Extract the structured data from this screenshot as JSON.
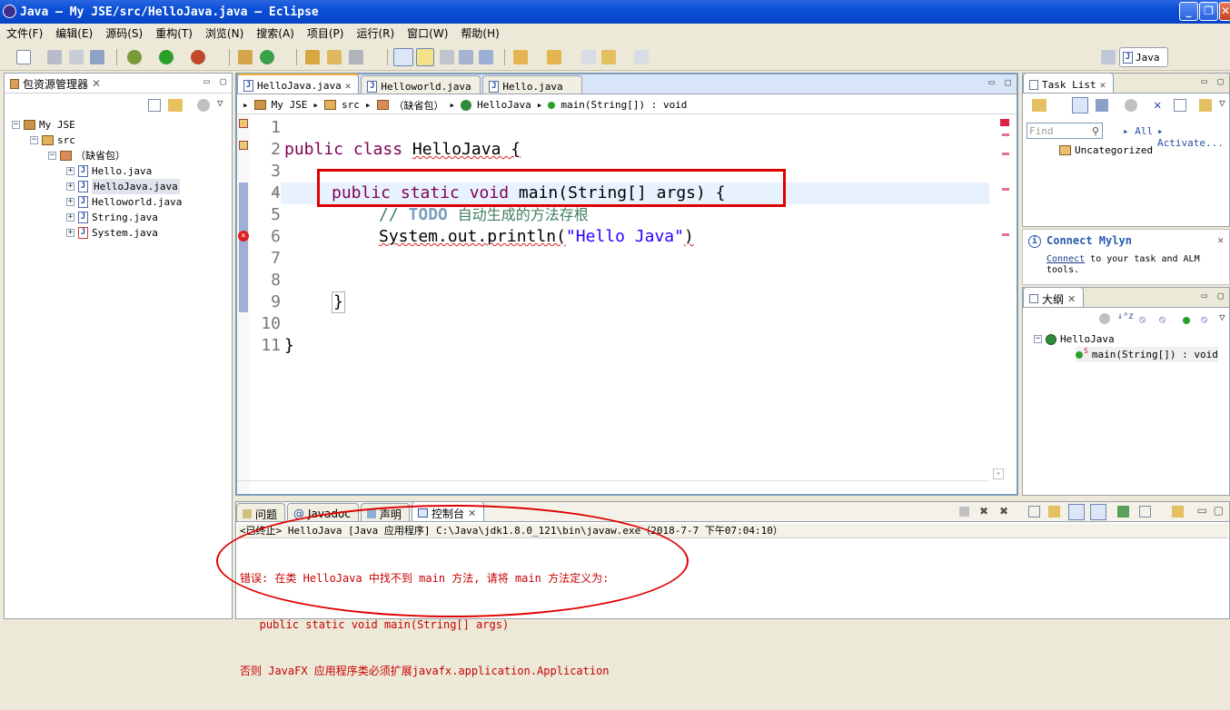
{
  "window": {
    "title": "Java — My JSE/src/HelloJava.java — Eclipse"
  },
  "menu": [
    "文件(F)",
    "编辑(E)",
    "源码(S)",
    "重构(T)",
    "浏览(N)",
    "搜索(A)",
    "项目(P)",
    "运行(R)",
    "窗口(W)",
    "帮助(H)"
  ],
  "perspective": {
    "label": "Java"
  },
  "package_explorer": {
    "title": "包资源管理器",
    "project": "My JSE",
    "src": "src",
    "default_pkg": "（缺省包）",
    "files": [
      "Hello.java",
      "HelloJava.java",
      "Helloworld.java",
      "String.java",
      "System.java"
    ],
    "selected": "HelloJava.java"
  },
  "editor": {
    "tabs": [
      "HelloJava.java",
      "Helloworld.java",
      "Hello.java"
    ],
    "breadcrumb": [
      "My JSE",
      "src",
      "（缺省包）",
      "HelloJava",
      "main(String[]) : void"
    ],
    "line_numbers": [
      "1",
      "2",
      "3",
      "4",
      "5",
      "6",
      "7",
      "8",
      "9",
      "10",
      "11"
    ],
    "code": {
      "l2_kw": "public class",
      "l2_name": "HelloJava {",
      "l4_kw": "public static void",
      "l4_rest": "main(String[] args)",
      "l4_brace": "{",
      "l5_slash": "//",
      "l5_todo": "TODO",
      "l5_text": "自动生成的方法存根",
      "l6_pre": "System.out.println(",
      "l6_str": "\"Hello Java\"",
      "l6_post": ")",
      "l9": "}",
      "l11": "}"
    }
  },
  "task_list": {
    "title": "Task List",
    "find_placeholder": "Find",
    "all": "All",
    "activate": "Activate...",
    "uncategorized": "Uncategorized"
  },
  "mylyn": {
    "title": "Connect Mylyn",
    "link": "Connect",
    "text1": " to your task and ALM",
    "text2": "tools."
  },
  "outline": {
    "title": "大纲",
    "class": "HelloJava",
    "method": "main(String[]) : void"
  },
  "console": {
    "tabs": [
      "问题",
      "Javadoc",
      "声明",
      "控制台"
    ],
    "header": "<已终止> HelloJava [Java 应用程序] C:\\Java\\jdk1.8.0_121\\bin\\javaw.exe（2018-7-7 下午07:04:10）",
    "lines": [
      "错误: 在类 HelloJava 中找不到 main 方法, 请将 main 方法定义为:",
      "   public static void main(String[] args)",
      "否则 JavaFX 应用程序类必须扩展javafx.application.Application"
    ]
  },
  "colors": {
    "keyword": "#7f0055",
    "string": "#2a00ff",
    "comment": "#3f7f5f",
    "error": "#c80000",
    "highlight_line": "#e8f2fe",
    "annotation": "#e00000"
  }
}
